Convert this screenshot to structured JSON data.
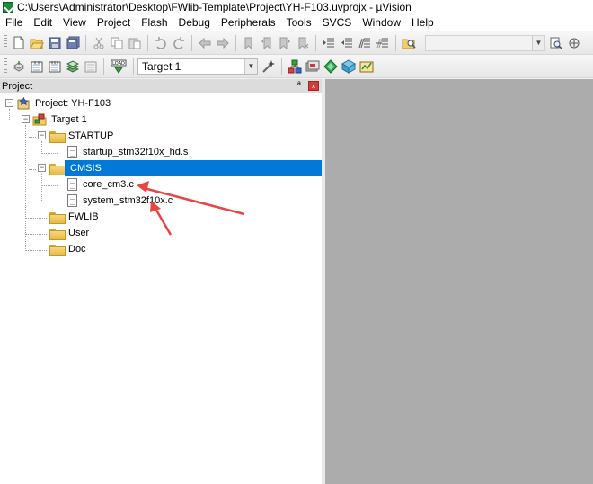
{
  "window": {
    "title": "C:\\Users\\Administrator\\Desktop\\FWlib-Template\\Project\\YH-F103.uvprojx - µVision"
  },
  "menu": [
    {
      "label": "File"
    },
    {
      "label": "Edit"
    },
    {
      "label": "View"
    },
    {
      "label": "Project"
    },
    {
      "label": "Flash"
    },
    {
      "label": "Debug"
    },
    {
      "label": "Peripherals"
    },
    {
      "label": "Tools"
    },
    {
      "label": "SVCS"
    },
    {
      "label": "Window"
    },
    {
      "label": "Help"
    }
  ],
  "toolbar2": {
    "load_label": "LOAD",
    "target_select": "Target 1"
  },
  "panel": {
    "title": "Project",
    "pin_glyph": "ª",
    "close_glyph": "×"
  },
  "tree": {
    "expanded_glyph": "−",
    "project": "Project: YH-F103",
    "target": "Target 1",
    "groups": [
      {
        "label": "STARTUP",
        "files": [
          "startup_stm32f10x_hd.s"
        ]
      },
      {
        "label": "CMSIS",
        "files": [
          "core_cm3.c",
          "system_stm32f10x.c"
        ]
      },
      {
        "label": "FWLIB"
      },
      {
        "label": "User"
      },
      {
        "label": "Doc"
      }
    ],
    "selected": "CMSIS"
  },
  "colors": {
    "selection": "#0078d7",
    "arrow": "#e84545",
    "editor_bg": "#acacac",
    "folder": "#e8b845"
  },
  "icons": {
    "new_file": "new-file-icon",
    "open": "open-folder-icon",
    "save": "save-icon",
    "save_all": "save-all-icon",
    "cut": "cut-icon",
    "copy": "copy-icon",
    "paste": "paste-icon",
    "undo": "undo-icon",
    "redo": "redo-icon",
    "nav_back": "navigate-back-icon",
    "nav_forward": "navigate-forward-icon",
    "build": "build-icon",
    "download": "download-load-icon"
  }
}
